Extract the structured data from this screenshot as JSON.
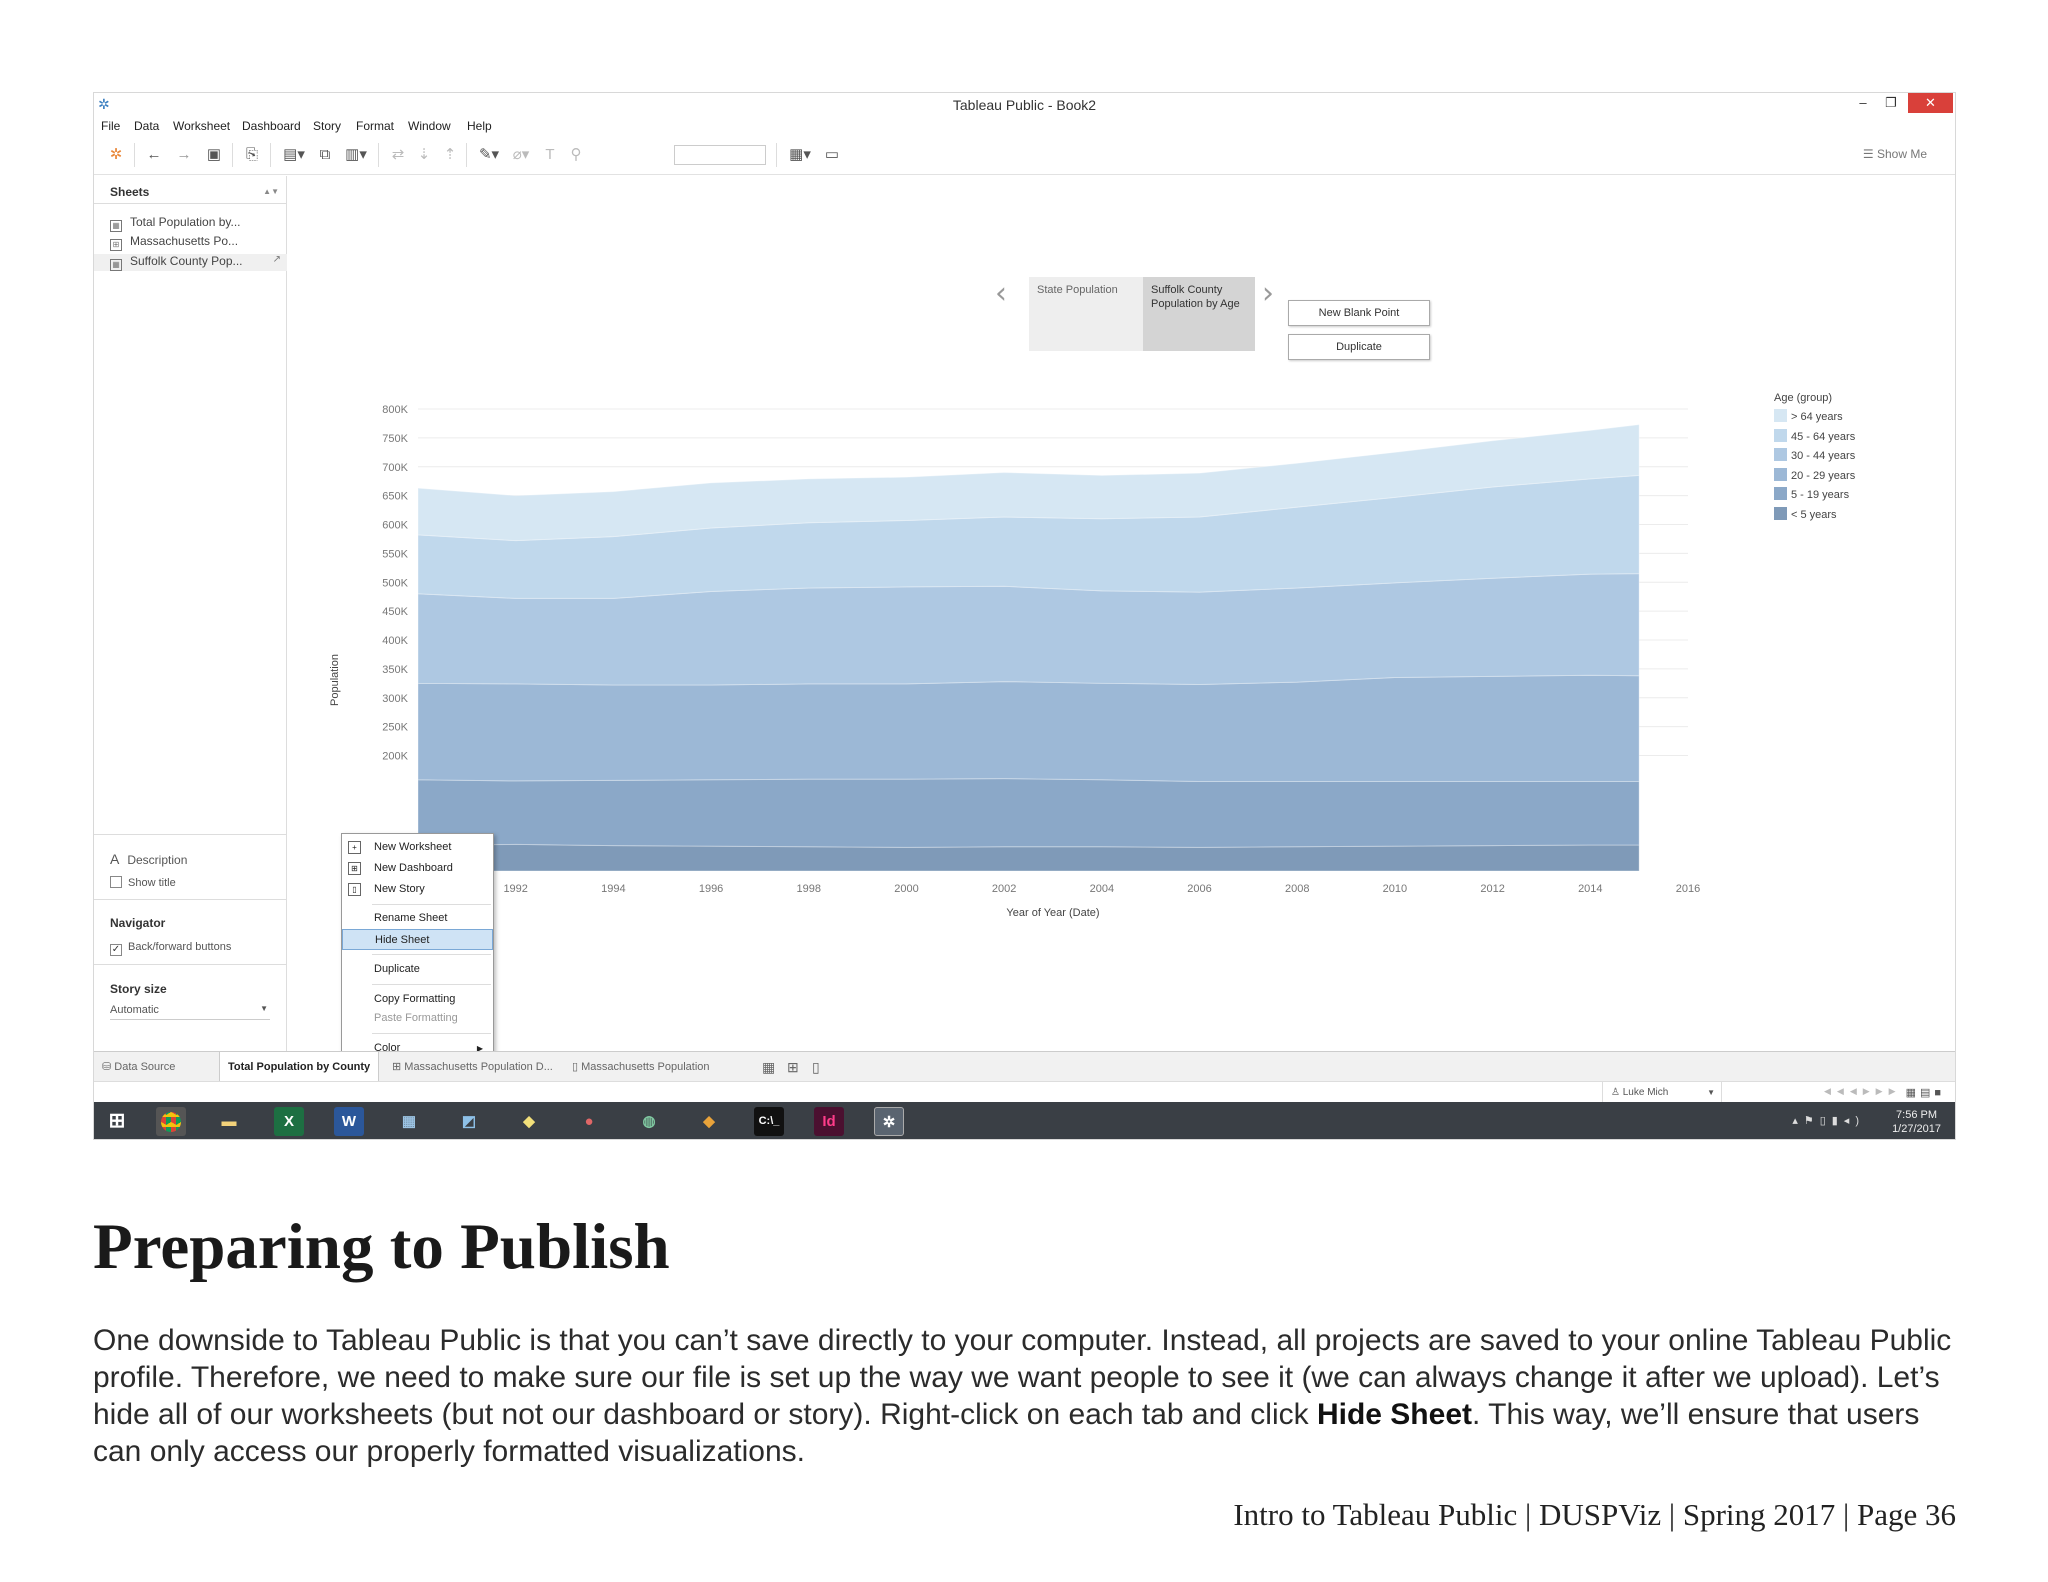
{
  "window": {
    "title": "Tableau Public - Book2",
    "minimize": "–",
    "restore": "❐",
    "close": "✕"
  },
  "menubar": [
    "File",
    "Data",
    "Worksheet",
    "Dashboard",
    "Story",
    "Format",
    "Window",
    "Help"
  ],
  "toolbar": {
    "show_me": "Show Me"
  },
  "sidebar": {
    "sheets_header": "Sheets",
    "sheets": [
      "Total Population by...",
      "Massachusetts Po...",
      "Suffolk County Pop..."
    ],
    "description_label": "Description",
    "show_title_label": "Show title",
    "navigator_header": "Navigator",
    "back_forward_label": "Back/forward buttons",
    "story_size_header": "Story size",
    "story_size_value": "Automatic"
  },
  "story": {
    "points": [
      "State Population",
      "Suffolk County Population by Age"
    ],
    "new_blank_point": "New Blank Point",
    "duplicate": "Duplicate"
  },
  "chart_data": {
    "type": "area",
    "stacked": true,
    "xlabel": "Year of Year (Date)",
    "ylabel": "Population",
    "x": [
      1990,
      1992,
      1994,
      1996,
      1998,
      2000,
      2002,
      2004,
      2006,
      2008,
      2010,
      2012,
      2014,
      2015
    ],
    "xticks": [
      "1992",
      "1994",
      "1996",
      "1998",
      "2000",
      "2002",
      "2004",
      "2006",
      "2008",
      "2010",
      "2012",
      "2014",
      "2016"
    ],
    "yticks": [
      "200K",
      "250K",
      "300K",
      "350K",
      "400K",
      "450K",
      "500K",
      "550K",
      "600K",
      "650K",
      "700K",
      "750K",
      "800K"
    ],
    "ylim": [
      0,
      800000
    ],
    "xlim": [
      1990,
      2016
    ],
    "legend_title": "Age (group)",
    "legend_position": "right",
    "series": [
      {
        "name": "< 5 years",
        "color": "#7f9ab8",
        "values": [
          45000,
          46000,
          44000,
          43000,
          42000,
          41000,
          42000,
          42000,
          41000,
          42000,
          43000,
          44000,
          45000,
          45000
        ]
      },
      {
        "name": "5 - 19 years",
        "color": "#8ba8c8",
        "values": [
          113000,
          110000,
          113000,
          115000,
          117000,
          118000,
          118000,
          116000,
          114000,
          113000,
          112000,
          111000,
          110000,
          110000
        ]
      },
      {
        "name": "20 - 29 years",
        "color": "#9cb8d6",
        "values": [
          167000,
          168000,
          165000,
          164000,
          165000,
          165000,
          168000,
          167000,
          168000,
          172000,
          180000,
          182000,
          184000,
          183000
        ]
      },
      {
        "name": "30 - 44 years",
        "color": "#aec8e2",
        "values": [
          155000,
          148000,
          150000,
          162000,
          166000,
          168000,
          165000,
          160000,
          160000,
          163000,
          164000,
          170000,
          175000,
          177000
        ]
      },
      {
        "name": "45 - 64 years",
        "color": "#c0d8ec",
        "values": [
          102000,
          100000,
          107000,
          110000,
          113000,
          115000,
          120000,
          125000,
          130000,
          140000,
          148000,
          158000,
          165000,
          170000
        ]
      },
      {
        "name": "> 64 years",
        "color": "#d6e7f3",
        "values": [
          81000,
          78000,
          78000,
          78000,
          76000,
          75000,
          77000,
          75000,
          76000,
          76000,
          78000,
          80000,
          84000,
          88000
        ]
      }
    ]
  },
  "context_menu": {
    "items": [
      "New Worksheet",
      "New Dashboard",
      "New Story",
      "Rename Sheet",
      "Hide Sheet",
      "Duplicate",
      "Copy Formatting",
      "Paste Formatting",
      "Color"
    ]
  },
  "tabs": {
    "data_source": "Data Source",
    "items": [
      "Total Population by County",
      "Massachusetts Population D...",
      "Massachusetts Population"
    ]
  },
  "statusbar": {
    "user": "Luke Mich"
  },
  "taskbar": {
    "time": "7:56 PM",
    "date": "1/27/2017"
  },
  "doc": {
    "heading": "Preparing to Publish",
    "body_1": "One downside to Tableau Public is that you can’t save directly to your computer. Instead, all projects are saved to your online Tableau Public profile. Therefore, we need to make sure our file is set up the way we want people to see it (we can always change it after we upload). Let’s hide all of our worksheets (but not our dashboard or story). Right-click on each tab and click ",
    "body_bold": "Hide Sheet",
    "body_2": ". This way, we’ll ensure that users can only access our properly formatted visualizations.",
    "footer": "Intro to Tableau Public | DUSPViz | Spring 2017 | Page 36"
  }
}
